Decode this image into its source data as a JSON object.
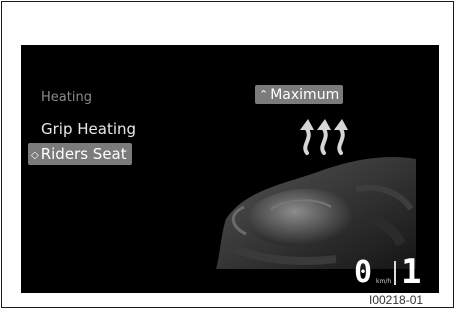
{
  "menu": {
    "header": "Heating",
    "items": [
      {
        "label": "Grip Heating",
        "selected": false
      },
      {
        "label": "Riders Seat",
        "selected": true
      }
    ],
    "selector_glyph": "◇"
  },
  "value": {
    "label": "Maximum",
    "chevron_glyph": "⌃"
  },
  "status": {
    "speed": "0",
    "speed_unit": "km/h",
    "gear": "1"
  },
  "figure_id": "I00218-01",
  "colors": {
    "screen_bg": "#000000",
    "highlight": "#7b7b7b",
    "text": "#e9e9e9",
    "header_text": "#8a8a8a"
  },
  "icons": {
    "heat": "heat-waves-icon",
    "illustration": "motorcycle-seat-illustration"
  }
}
